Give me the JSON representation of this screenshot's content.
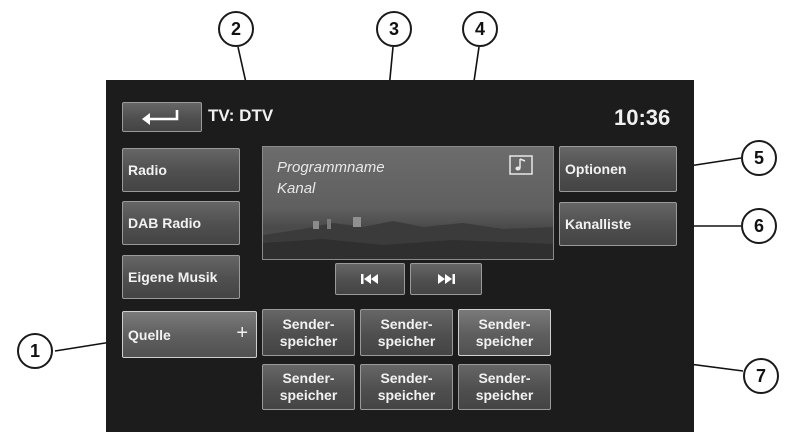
{
  "header": {
    "title": "TV: DTV",
    "clock": "10:36"
  },
  "sidebar": {
    "items": [
      {
        "label": "Radio"
      },
      {
        "label": "DAB Radio"
      },
      {
        "label": "Eigene Musik"
      },
      {
        "label": "Quelle",
        "suffix": "+"
      }
    ]
  },
  "video": {
    "programme": "Programmname",
    "channel": "Kanal",
    "music_icon": "music-note-icon"
  },
  "right_buttons": {
    "options": "Optionen",
    "channel_list": "Kanalliste"
  },
  "controls": {
    "prev_icon": "skip-previous-icon",
    "next_icon": "skip-next-icon"
  },
  "presets": [
    {
      "label": "Sender-\nspeicher"
    },
    {
      "label": "Sender-\nspeicher"
    },
    {
      "label": "Sender-\nspeicher"
    },
    {
      "label": "Sender-\nspeicher"
    },
    {
      "label": "Sender-\nspeicher"
    },
    {
      "label": "Sender-\nspeicher"
    }
  ],
  "callouts": [
    "1",
    "2",
    "3",
    "4",
    "5",
    "6",
    "7"
  ],
  "colors": {
    "screen_bg": "#1c1c1c",
    "button_bg": "#555555",
    "text": "#f2f2f2"
  }
}
